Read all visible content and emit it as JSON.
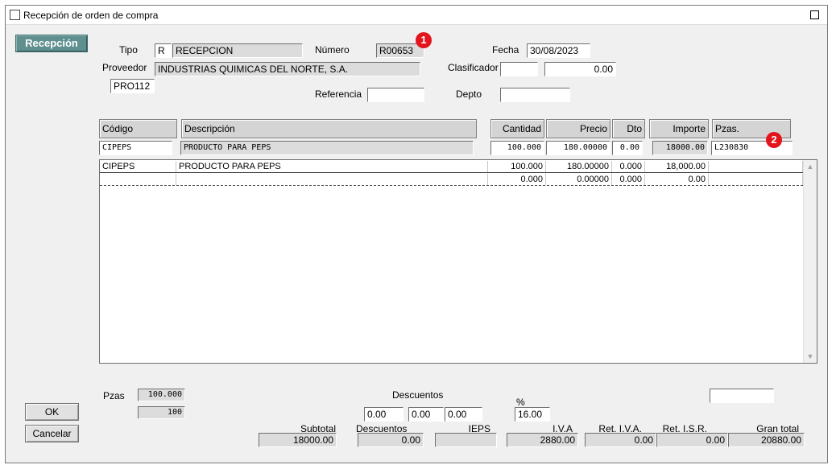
{
  "window": {
    "title": "Recepción de orden de compra"
  },
  "recepcion_button": "Recepción",
  "header": {
    "tipo_label": "Tipo",
    "tipo_code": "R",
    "tipo_name": "RECEPCION",
    "numero_label": "Número",
    "numero_value": "R00653",
    "fecha_label": "Fecha",
    "fecha_value": "30/08/2023",
    "proveedor_label": "Proveedor",
    "proveedor_name": "INDUSTRIAS QUIMICAS DEL NORTE, S.A.",
    "proveedor_code": "PRO112",
    "clasificador_label": "Clasificador",
    "clasificador_code": "",
    "clasificador_value": "0.00",
    "referencia_label": "Referencia",
    "referencia_value": "",
    "depto_label": "Depto",
    "depto_value": ""
  },
  "columns": {
    "codigo": "Código",
    "descripcion": "Descripción",
    "cantidad": "Cantidad",
    "precio": "Precio",
    "dto": "Dto",
    "importe": "Importe",
    "pzas": "Pzas."
  },
  "entry": {
    "codigo": "CIPEPS",
    "descripcion": "PRODUCTO PARA PEPS",
    "cantidad": "100.000",
    "precio": "180.00000",
    "dto": "0.00",
    "importe": "18000.00",
    "pzas": "L230830"
  },
  "rows": [
    {
      "codigo": "CIPEPS",
      "descripcion": "PRODUCTO PARA PEPS",
      "cantidad": "100.000",
      "precio": "180.00000",
      "dto": "0.000",
      "importe": "18,000.00",
      "pzas": ""
    },
    {
      "codigo": "",
      "descripcion": "",
      "cantidad": "0.000",
      "precio": "0.00000",
      "dto": "0.000",
      "importe": "0.00",
      "pzas": ""
    }
  ],
  "badges": {
    "one": "1",
    "two": "2"
  },
  "footer": {
    "pzas_label": "Pzas",
    "pzas_value1": "100.000",
    "pzas_value2": "100",
    "descuentos_label": "Descuentos",
    "desc1": "0.00",
    "desc2": "0.00",
    "desc3": "0.00",
    "pct_label": "%",
    "pct_value": "16.00",
    "extra_field": "",
    "ok_label": "OK",
    "cancel_label": "Cancelar",
    "subtotal_label": "Subtotal",
    "subtotal_value": "18000.00",
    "descuentos_total_label": "Descuentos",
    "descuentos_total_value": "0.00",
    "ieps_label": "IEPS",
    "ieps_value": "",
    "iva_label": "I.V.A",
    "iva_value": "2880.00",
    "ret_iva_label": "Ret. I.V.A.",
    "ret_iva_value": "0.00",
    "ret_isr_label": "Ret. I.S.R.",
    "ret_isr_value": "0.00",
    "gran_total_label": "Gran total",
    "gran_total_value": "20880.00"
  },
  "colors": {
    "badge": "#e4141c",
    "recepcion_button": "#5f8f8f"
  }
}
